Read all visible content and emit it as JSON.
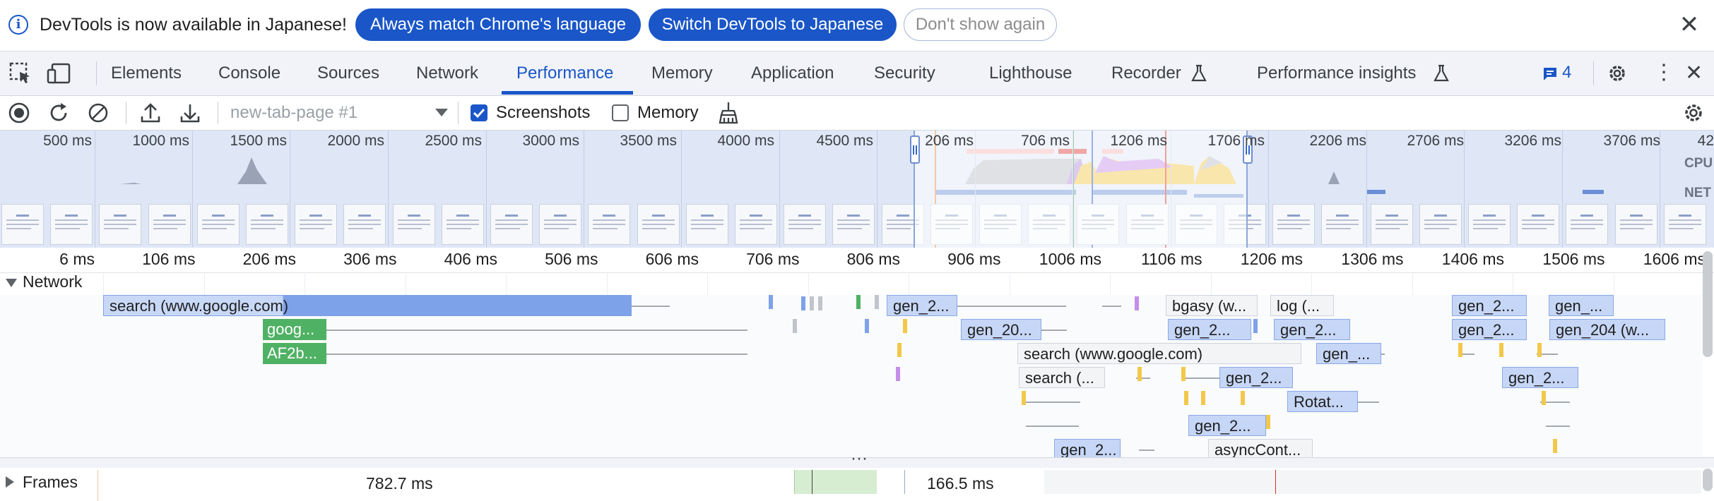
{
  "infobar": {
    "message": "DevTools is now available in Japanese!",
    "btn_match": "Always match Chrome's language",
    "btn_switch": "Switch DevTools to Japanese",
    "btn_dismiss": "Don't show again"
  },
  "tabs": [
    {
      "label": "Elements"
    },
    {
      "label": "Console"
    },
    {
      "label": "Sources"
    },
    {
      "label": "Network"
    },
    {
      "label": "Performance"
    },
    {
      "label": "Memory"
    },
    {
      "label": "Application"
    },
    {
      "label": "Security"
    },
    {
      "label": "Lighthouse"
    },
    {
      "label": "Recorder"
    },
    {
      "label": "Performance insights"
    }
  ],
  "active_tab": "Performance",
  "issues_count": "4",
  "toolbar": {
    "recording_select": "new-tab-page #1",
    "screenshots_label": "Screenshots",
    "screenshots_checked": true,
    "memory_label": "Memory",
    "memory_checked": false
  },
  "overview": {
    "labels_left": [
      "500 ms",
      "1000 ms",
      "1500 ms",
      "2000 ms",
      "2500 ms",
      "3000 ms",
      "3500 ms",
      "4000 ms",
      "4500 ms"
    ],
    "labels_sel": [
      "206 ms",
      "706 ms",
      "1206 ms",
      "1706 ms"
    ],
    "labels_right": [
      "2206 ms",
      "2706 ms",
      "3206 ms",
      "3706 ms",
      "42"
    ],
    "cpu_label": "CPU",
    "net_label": "NET"
  },
  "ruler": [
    "6 ms",
    "106 ms",
    "206 ms",
    "306 ms",
    "406 ms",
    "506 ms",
    "606 ms",
    "706 ms",
    "806 ms",
    "906 ms",
    "1006 ms",
    "1106 ms",
    "1206 ms",
    "1306 ms",
    "1406 ms",
    "1506 ms",
    "1606 ms"
  ],
  "network": {
    "title": "Network",
    "requests": [
      "search (www.google.com)",
      "goog...",
      "AF2b...",
      "gen_2...",
      "gen_20...",
      "search (www.google.com)",
      "search (...",
      "bgasy (w...",
      "log (...",
      "gen_2...",
      "gen_2...",
      "gen_...",
      "gen_2...",
      "Rotat...",
      "gen_2...",
      "gen_2...",
      "asyncCont...",
      "gen_2...",
      "gen_...",
      "gen_2...",
      "gen_204 (w...",
      "gen_2..."
    ]
  },
  "frames": {
    "title": "Frames",
    "value1": "782.7 ms",
    "value2": "166.5 ms"
  },
  "colors": {
    "accent": "#1a56c8",
    "overview_bg": "#dfe7f7",
    "request_blue": "#a7c1f2",
    "request_green": "#4fb164"
  }
}
